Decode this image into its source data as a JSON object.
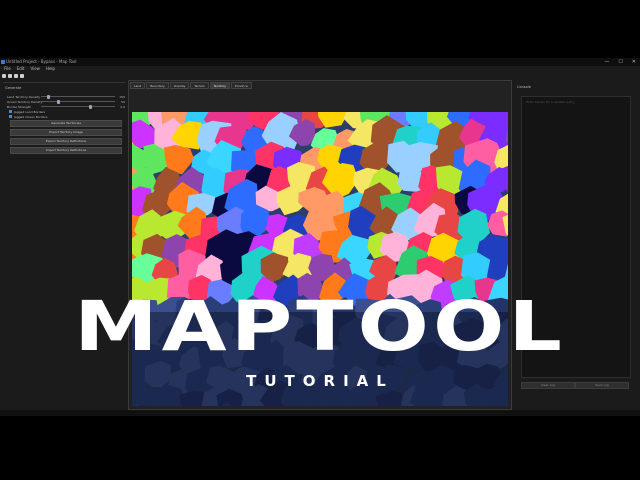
{
  "window": {
    "title": "Untitled Project - Bypass - Map Tool",
    "controls": [
      "—",
      "☐",
      "✕"
    ]
  },
  "menu": [
    "File",
    "Edit",
    "View",
    "Help"
  ],
  "left_panel": {
    "title": "Generate",
    "sliders": [
      {
        "label": "Land Territory Density",
        "value": "150",
        "fraction": 0.08
      },
      {
        "label": "Ocean Territory Density",
        "value": "50",
        "fraction": 0.22
      },
      {
        "label": "Border Strength",
        "value": "2.0",
        "fraction": 0.65
      }
    ],
    "checkboxes": [
      {
        "label": "Jagged Land Borders",
        "checked": true
      },
      {
        "label": "Jagged Ocean Borders",
        "checked": true
      }
    ],
    "buttons": [
      "Generate Territories",
      "Export Territory Image",
      "Export Territory Definitions",
      "Import Territory Definitions"
    ]
  },
  "tabs": [
    {
      "label": "Land",
      "selected": false
    },
    {
      "label": "Boundary",
      "selected": false
    },
    {
      "label": "Overlay",
      "selected": false
    },
    {
      "label": "Terrain",
      "selected": false
    },
    {
      "label": "Territory",
      "selected": true
    },
    {
      "label": "Province",
      "selected": false
    }
  ],
  "right_panel": {
    "title": "Console",
    "placeholder": "Enter terrain for a random entry",
    "buttons": [
      "Clear Log",
      "Save Log"
    ]
  },
  "overlay": {
    "headline": "MAPTOOL",
    "subtitle": "TUTORIAL"
  }
}
